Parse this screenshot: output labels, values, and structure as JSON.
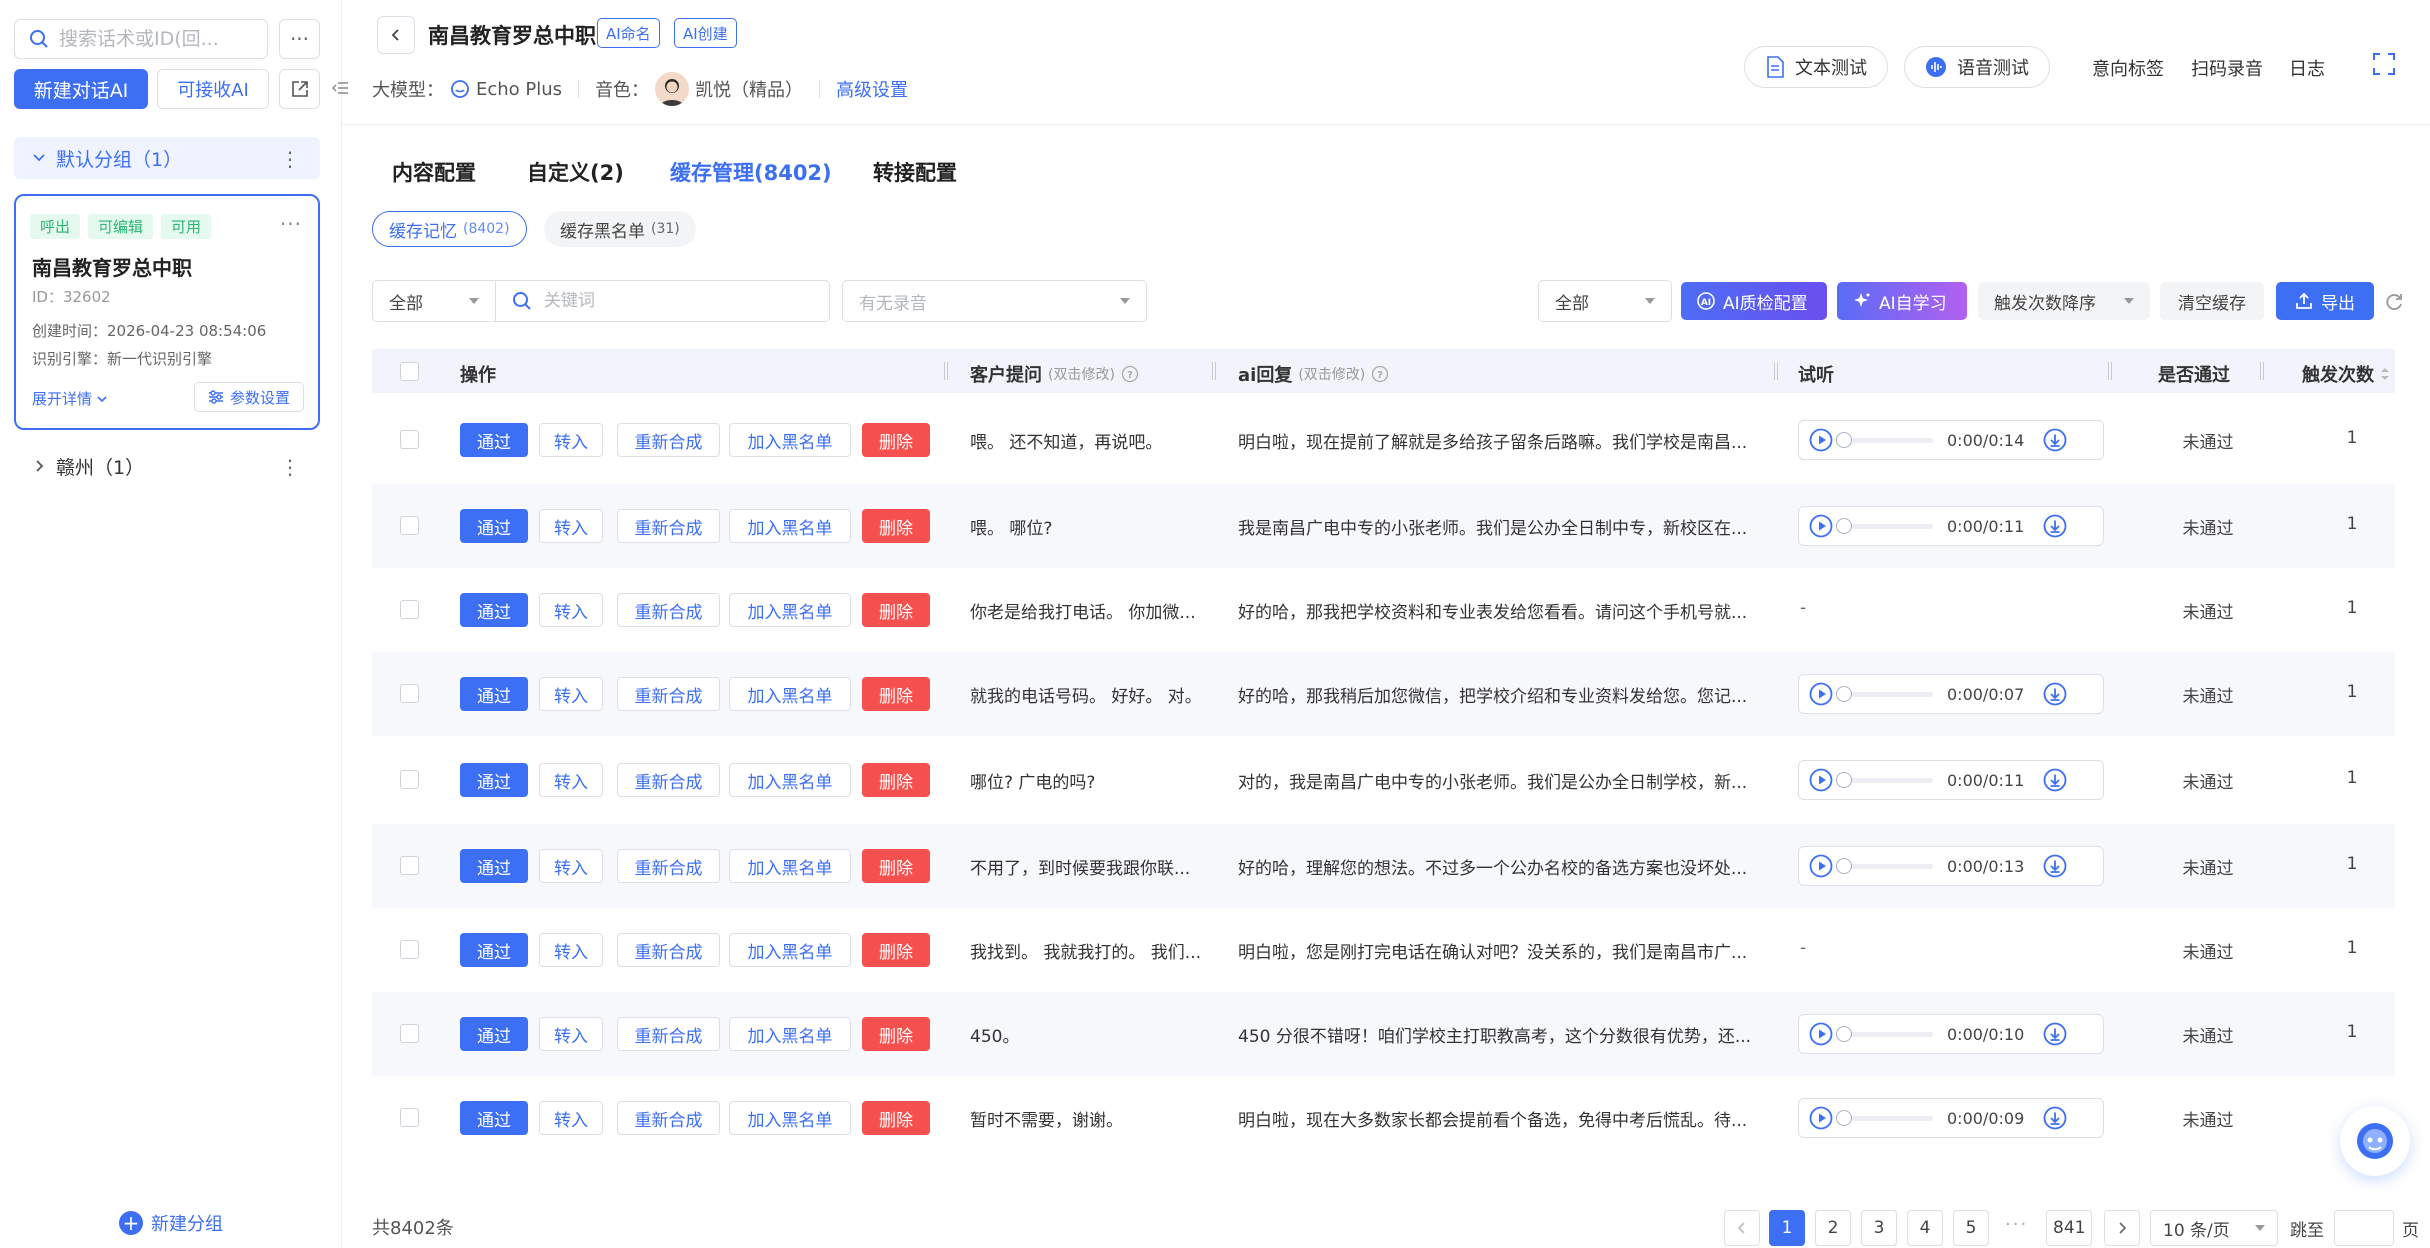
{
  "sidebar": {
    "search_placeholder": "搜索话术或ID(回...",
    "more": "···",
    "new_ai": "新建对话AI",
    "recv_ai": "可接收AI",
    "groups": {
      "default": {
        "label": "默认分组（1）"
      },
      "ganzhou": {
        "label": "赣州（1）"
      }
    },
    "card": {
      "tags": [
        "呼出",
        "可编辑",
        "可用"
      ],
      "title": "南昌教育罗总中职",
      "id": "ID：32602",
      "created": "创建时间：2026-04-23 08:54:06",
      "engine": "识别引擎：新一代识别引擎",
      "expand": "展开详情",
      "param": "参数设置"
    },
    "new_group": "新建分组"
  },
  "header": {
    "title": "南昌教育罗总中职",
    "tag_naming": "AI命名",
    "tag_created": "AI创建",
    "model_label": "大模型：",
    "model_value": "Echo Plus",
    "voice_label": "音色：",
    "voice_value": "凯悦（精品）",
    "advanced": "高级设置",
    "text_test": "文本测试",
    "voice_test": "语音测试",
    "intent": "意向标签",
    "scan": "扫码录音",
    "log": "日志"
  },
  "tabs": [
    "内容配置",
    "自定义(2)",
    "缓存管理(8402)",
    "转接配置"
  ],
  "subtabs": [
    {
      "label": "缓存记忆",
      "count": "(8402)"
    },
    {
      "label": "缓存黑名单",
      "count": "(31)"
    }
  ],
  "filters": {
    "scope": "全部",
    "keyword_placeholder": "关键词",
    "recording_placeholder": "有无录音",
    "status": "全部",
    "ai_qc": "AI质检配置",
    "ai_learn": "AI自学习",
    "sort": "触发次数降序",
    "clear": "清空缓存",
    "export": "导出"
  },
  "table": {
    "headers": {
      "op": "操作",
      "q": "客户提问",
      "q_hint": "(双击修改)",
      "a": "ai回复",
      "a_hint": "(双击修改)",
      "listen": "试听",
      "pass": "是否通过",
      "count": "触发次数"
    },
    "actions": {
      "pass": "通过",
      "to": "转入",
      "re": "重新合成",
      "bl": "加入黑名单",
      "del": "删除"
    },
    "rows": [
      {
        "q": "喂。 还不知道，再说吧。",
        "a": "明白啦，现在提前了解就是多给孩子留条后路嘛。我们学校是南昌...",
        "audio": "0:00/0:14",
        "pass": "未通过",
        "count": "1"
      },
      {
        "q": "喂。 哪位?",
        "a": "我是南昌广电中专的小张老师。我们是公办全日制中专，新校区在...",
        "audio": "0:00/0:11",
        "pass": "未通过",
        "count": "1"
      },
      {
        "q": "你老是给我打电话。 你加微...",
        "a": "好的哈，那我把学校资料和专业表发给您看看。请问这个手机号就...",
        "audio": "-",
        "pass": "未通过",
        "count": "1"
      },
      {
        "q": "就我的电话号码。 好好。 对。",
        "a": "好的哈，那我稍后加您微信，把学校介绍和专业资料发给您。您记...",
        "audio": "0:00/0:07",
        "pass": "未通过",
        "count": "1"
      },
      {
        "q": "哪位? 广电的吗?",
        "a": "对的，我是南昌广电中专的小张老师。我们是公办全日制学校，新...",
        "audio": "0:00/0:11",
        "pass": "未通过",
        "count": "1"
      },
      {
        "q": "不用了，到时候要我跟你联...",
        "a": "好的哈，理解您的想法。不过多一个公办名校的备选方案也没坏处...",
        "audio": "0:00/0:13",
        "pass": "未通过",
        "count": "1"
      },
      {
        "q": "我找到。 我就我打的。 我们...",
        "a": "明白啦，您是刚打完电话在确认对吧？没关系的，我们是南昌市广...",
        "audio": "-",
        "pass": "未通过",
        "count": "1"
      },
      {
        "q": "450。",
        "a": "450 分很不错呀！咱们学校主打职教高考，这个分数很有优势，还...",
        "audio": "0:00/0:10",
        "pass": "未通过",
        "count": "1"
      },
      {
        "q": "暂时不需要，谢谢。",
        "a": "明白啦，现在大多数家长都会提前看个备选，免得中考后慌乱。待...",
        "audio": "0:00/0:09",
        "pass": "未通过",
        "count": ""
      }
    ]
  },
  "pagination": {
    "total": "共8402条",
    "pages": [
      "1",
      "2",
      "3",
      "4",
      "5"
    ],
    "ellipsis": "···",
    "last": "841",
    "size": "10 条/页",
    "jump": "跳至",
    "page": "页"
  },
  "colors": {
    "primary": "#3d6ff5",
    "danger": "#f5504e",
    "success": "#2bb673"
  }
}
